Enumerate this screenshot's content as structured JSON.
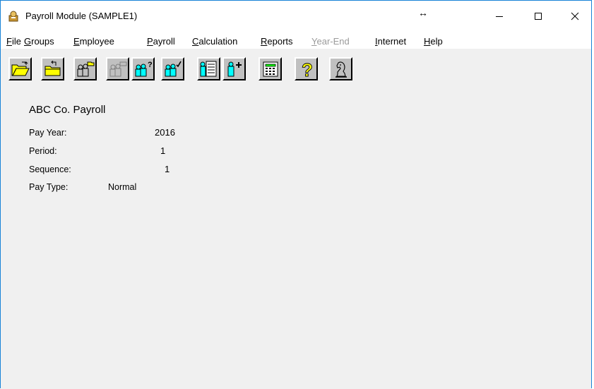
{
  "window": {
    "title": "Payroll Module  (SAMPLE1)",
    "app_icon": "payroll-app-icon",
    "resize_glyph": "↔",
    "controls": {
      "minimize": "minimize-icon",
      "maximize": "maximize-icon",
      "close": "close-icon"
    }
  },
  "menubar": {
    "items": [
      {
        "hot": "F",
        "rest": "ile",
        "enabled": true
      },
      {
        "hot": "G",
        "rest": "roups",
        "enabled": true
      },
      {
        "hot": "E",
        "rest": "mployee",
        "enabled": true
      },
      {
        "hot": "P",
        "rest": "ayroll",
        "enabled": true
      },
      {
        "hot": "C",
        "rest": "alculation",
        "enabled": true
      },
      {
        "hot": "R",
        "rest": "eports",
        "enabled": true
      },
      {
        "hot": "Y",
        "rest": "ear-End",
        "enabled": false
      },
      {
        "hot": "I",
        "rest": "nternet",
        "enabled": true
      },
      {
        "hot": "H",
        "rest": "elp",
        "enabled": true
      }
    ]
  },
  "toolbar": {
    "buttons": [
      {
        "icon": "open-folder-icon",
        "enabled": true
      },
      {
        "icon": "close-folder-icon",
        "enabled": true
      },
      {
        "icon": "group-open-icon",
        "enabled": true
      },
      {
        "icon": "group-close-icon",
        "enabled": false
      },
      {
        "icon": "group-query-icon",
        "enabled": true
      },
      {
        "icon": "group-check-icon",
        "enabled": true
      },
      {
        "icon": "employee-file-icon",
        "enabled": true
      },
      {
        "icon": "add-employee-icon",
        "enabled": true
      },
      {
        "icon": "calculator-icon",
        "enabled": true
      },
      {
        "icon": "help-question-icon",
        "enabled": true
      },
      {
        "icon": "chess-knight-icon",
        "enabled": true
      }
    ]
  },
  "payroll": {
    "company": "ABC Co. Payroll",
    "pay_year_label": "Pay Year:",
    "pay_year": "2016",
    "period_label": "Period:",
    "period": "1",
    "sequence_label": "Sequence:",
    "sequence": "1",
    "pay_type_label": "Pay Type:",
    "pay_type": "Normal"
  },
  "colors": {
    "client_bg": "#f0f0f0",
    "button_face": "#c0c0c0",
    "folder_yellow": "#ffff00",
    "people_cyan": "#00ffff",
    "window_border": "#1883d7",
    "disabled_text": "#9a9a9a"
  }
}
